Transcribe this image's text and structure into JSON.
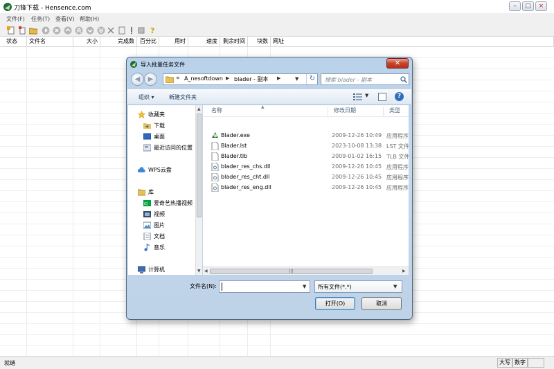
{
  "window": {
    "title": "刀锋下载 - Hensence.com"
  },
  "menu": [
    "文件(F)",
    "任务(T)",
    "查看(V)",
    "帮助(H)"
  ],
  "list_columns": [
    "状态",
    "文件名",
    "大小",
    "完成数",
    "百分比",
    "用时",
    "速度",
    "剩余时间",
    "块数",
    "网址"
  ],
  "status": {
    "text": "就绪",
    "caps": "大写",
    "num": "数字"
  },
  "dialog": {
    "title": "导入批量任务文件",
    "breadcrumb": {
      "prefix": "«",
      "items": [
        "A_nesoftdown",
        "blader - 副本"
      ]
    },
    "search_placeholder": "搜索 blader - 副本",
    "commands": {
      "organize": "组织 ▾",
      "new_folder": "新建文件夹"
    },
    "nav": {
      "favorites_label": "收藏夹",
      "favorites": [
        "下载",
        "桌面",
        "最近访问的位置"
      ],
      "wps": "WPS云盘",
      "libraries_label": "库",
      "libraries": [
        "爱奇艺热播视频",
        "视频",
        "图片",
        "文档",
        "音乐"
      ],
      "computer": "计算机"
    },
    "file_columns": {
      "name": "名称",
      "date": "修改日期",
      "type": "类型"
    },
    "files": [
      {
        "name": "Blader.exe",
        "date": "2009-12-26 10:49",
        "type": "应用程序",
        "icon": "exe-icon"
      },
      {
        "name": "Blader.lst",
        "date": "2023-10-08 13:38",
        "type": "LST 文件",
        "icon": "file-icon"
      },
      {
        "name": "Blader.tlb",
        "date": "2009-01-02 16:15",
        "type": "TLB 文件",
        "icon": "file-icon"
      },
      {
        "name": "blader_res_chs.dll",
        "date": "2009-12-26 10:45",
        "type": "应用程序",
        "icon": "dll-icon"
      },
      {
        "name": "blader_res_cht.dll",
        "date": "2009-12-26 10:45",
        "type": "应用程序",
        "icon": "dll-icon"
      },
      {
        "name": "blader_res_eng.dll",
        "date": "2009-12-26 10:45",
        "type": "应用程序",
        "icon": "dll-icon"
      }
    ],
    "filename_label": "文件名(N):",
    "filename_value": "",
    "filter": "所有文件(*.*)",
    "open_label": "打开(O)",
    "cancel_label": "取消"
  }
}
